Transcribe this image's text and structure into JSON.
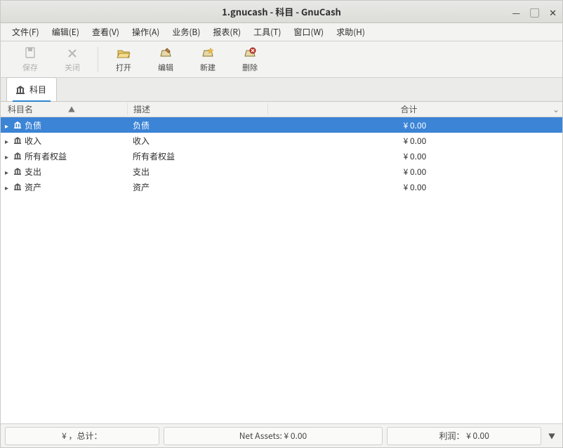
{
  "window": {
    "title": "1.gnucash - 科目 - GnuCash"
  },
  "menubar": [
    {
      "label": "文件(F)"
    },
    {
      "label": "编辑(E)"
    },
    {
      "label": "查看(V)"
    },
    {
      "label": "操作(A)"
    },
    {
      "label": "业务(B)"
    },
    {
      "label": "报表(R)"
    },
    {
      "label": "工具(T)"
    },
    {
      "label": "窗口(W)"
    },
    {
      "label": "求助(H)"
    }
  ],
  "toolbar": {
    "save": {
      "label": "保存"
    },
    "close": {
      "label": "关闭"
    },
    "open": {
      "label": "打开"
    },
    "edit": {
      "label": "编辑"
    },
    "new": {
      "label": "新建"
    },
    "delete": {
      "label": "删除"
    }
  },
  "tab": {
    "label": "科目"
  },
  "columns": {
    "name": "科目名",
    "desc": "描述",
    "total": "合计"
  },
  "rows": [
    {
      "name": "负债",
      "desc": "负债",
      "total": "¥ 0.00",
      "selected": true
    },
    {
      "name": "收入",
      "desc": "收入",
      "total": "¥ 0.00",
      "selected": false
    },
    {
      "name": "所有者权益",
      "desc": "所有者权益",
      "total": "¥ 0.00",
      "selected": false
    },
    {
      "name": "支出",
      "desc": "支出",
      "total": "¥ 0.00",
      "selected": false
    },
    {
      "name": "资产",
      "desc": "资产",
      "total": "¥ 0.00",
      "selected": false
    }
  ],
  "status": {
    "currency": "¥ ，总计：",
    "netassets": "Net Assets: ¥ 0.00",
    "profit": "利润：  ¥ 0.00"
  }
}
